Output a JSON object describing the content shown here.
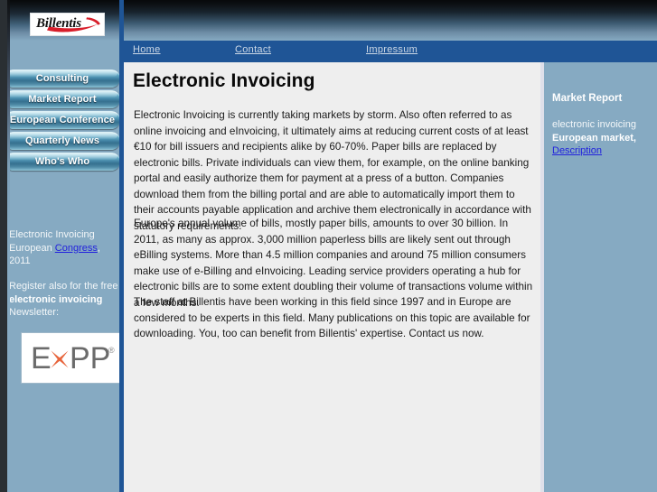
{
  "brand": {
    "logo_text": "Billentis",
    "logo_icon": "red-swoosh-icon"
  },
  "topnav": {
    "home": "Home",
    "contact": "Contact",
    "impressum": "Impressum"
  },
  "sidebar": {
    "buttons": [
      {
        "label": "Consulting"
      },
      {
        "label": "Market Report"
      },
      {
        "label": "European Conference"
      },
      {
        "label": "Quarterly News"
      },
      {
        "label": "Who's Who"
      }
    ],
    "promo": {
      "line1": "Electronic Invoicing",
      "line2_prefix": "European ",
      "line2_link": "Congress",
      "line2_suffix": ",",
      "line3": "2011"
    },
    "newsletter": {
      "line1": "Register also for the free",
      "line2_bold": "electronic invoicing",
      "line3": "Newsletter:"
    },
    "partner_logo": {
      "text_a": "E",
      "text_x": "x",
      "text_b": "PP",
      "mark": "®"
    }
  },
  "main": {
    "title": "Electronic Invoicing",
    "paragraphs": [
      "Electronic Invoicing is currently taking markets by storm. Also often referred to as online invoicing and eInvoicing, it ultimately aims at reducing current costs of at least €10 for bill issuers and recipients alike by 60-70%. Paper bills are replaced by electronic bills. Private individuals can view them, for example, on the online banking portal and easily authorize them for payment at a press of a button. Companies download them from the billing portal and are able to automatically import them to their accounts payable application and archive them electronically in accordance with statutory requirements.",
      "Europe's annual volume of bills, mostly paper bills, amounts to over 30 billion. In 2011, as many as approx. 3,000 million paperless bills are likely sent out through eBilling systems. More than 4.5 million companies and around 75 million consumers make use of e-Billing and eInvoicing. Leading service providers operating a hub for electronic bills are to some extent doubling their volume of transactions volume within a few months.",
      "The staff at Billentis have been working in this field since 1997 and in Europe are considered to be experts in this field. Many publications on this topic are available for downloading. You, too can benefit from Billentis' expertise. Contact us now."
    ]
  },
  "rightbar": {
    "title": "Market Report",
    "line1": "electronic invoicing",
    "line2_bold": "European market,",
    "link": "Description"
  },
  "colors": {
    "page_blue": "#86AAC2",
    "nav_blue": "#1F5596",
    "content_gray": "#EEEEEE",
    "link_blue": "#2222DD",
    "accent_red": "#D81E2A",
    "accent_orange": "#E8653C",
    "button_teal": "#3F7FA0"
  }
}
